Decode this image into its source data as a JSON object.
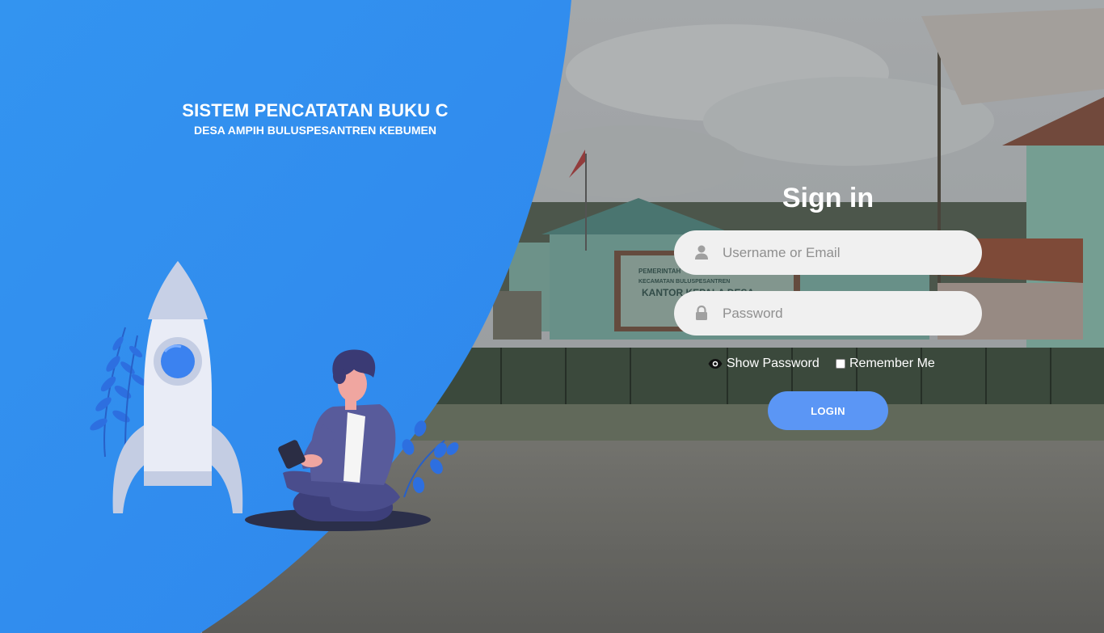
{
  "header": {
    "title": "SISTEM PENCATATAN BUKU C",
    "subtitle": "DESA AMPIH BULUSPESANTREN KEBUMEN"
  },
  "signin": {
    "title": "Sign in",
    "username_placeholder": "Username or Email",
    "username_value": "",
    "password_placeholder": "Password",
    "password_value": "",
    "show_password_label": "Show Password",
    "remember_me_label": "Remember Me",
    "remember_me_checked": false,
    "login_label": "LOGIN"
  },
  "background_sign": {
    "line1": "PEMERINTAH",
    "line2": "KECAMATAN BULUSPESANTREN",
    "line3": "KANTOR KEPALA DESA"
  },
  "icons": {
    "username": "user-icon",
    "password": "lock-icon",
    "show_password": "eye-icon"
  },
  "colors": {
    "brand_blue": "#2f8ff0",
    "login_button": "#5b96f5",
    "field_background": "#f0f0f0"
  }
}
